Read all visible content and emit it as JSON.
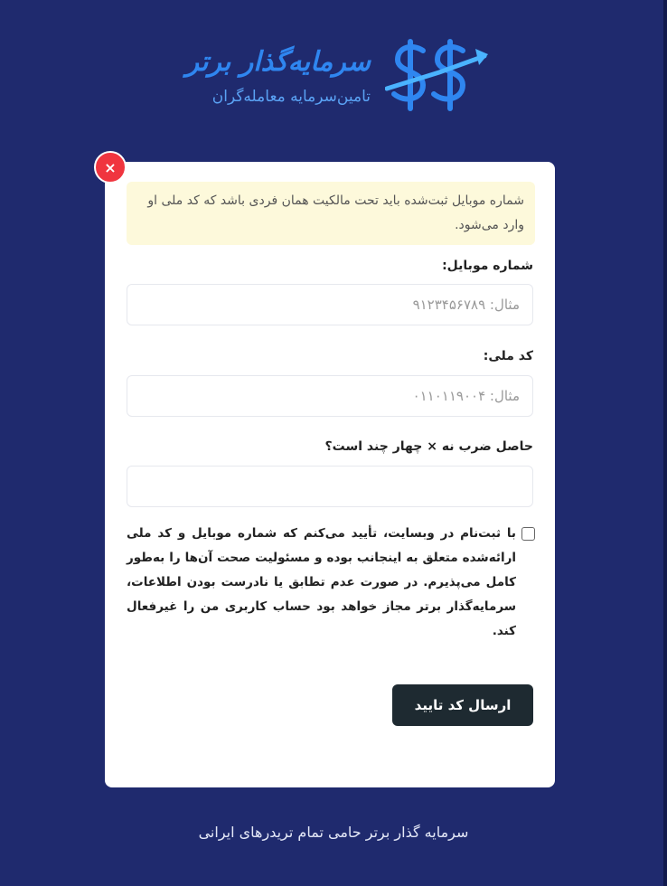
{
  "header": {
    "brand_name": "سرمایه‌گذار برتر",
    "tagline": "تامین‌سرمایه معامله‌گران",
    "logo_icon": "dollar-signs-logo-icon"
  },
  "colors": {
    "background": "#1f2a6e",
    "brand_blue": "#2f86f0",
    "close_red": "#f0353f",
    "notice_bg": "#fdf9db",
    "button_dark": "#1e2a31"
  },
  "card": {
    "close_label": "×",
    "notice": "شماره موبایل ثبت‌شده باید تحت مالکیت همان فردی باشد که کد ملی او وارد می‌شود.",
    "mobile": {
      "label": "شماره موبایل:",
      "value": "",
      "placeholder": "مثال: ۹۱۲۳۴۵۶۷۸۹"
    },
    "national_id": {
      "label": "کد ملی:",
      "value": "",
      "placeholder": "مثال: ۰۱۱۰۱۱۹۰۰۴"
    },
    "captcha": {
      "label": "حاصل ضرب نه × چهار چند است؟",
      "value": "",
      "placeholder": ""
    },
    "consent": {
      "checked": false,
      "text": "با ثبت‌نام در وبسایت، تأیید می‌کنم که شماره موبایل و کد ملی ارائه‌شده متعلق به اینجانب بوده و مسئولیت صحت آن‌ها را به‌طور کامل می‌پذیرم. در صورت عدم تطابق یا نادرست بودن اطلاعات، سرمایه‌گذار برتر مجاز خواهد بود حساب کاربری من را غیرفعال کند."
    },
    "submit_label": "ارسال کد تایید"
  },
  "footer": {
    "text": "سرمایه گذار برتر حامی تمام تریدرهای ایرانی"
  }
}
